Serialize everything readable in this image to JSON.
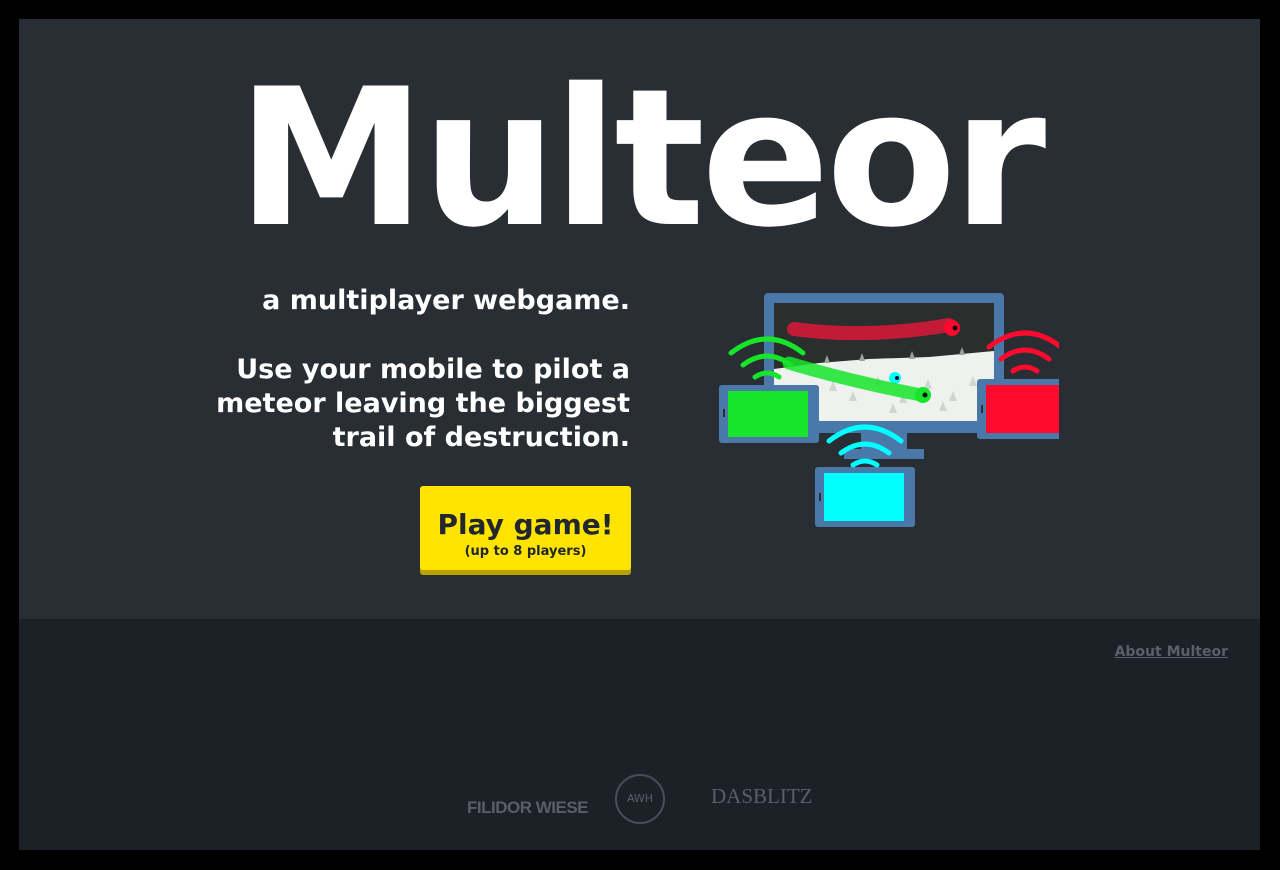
{
  "hero": {
    "title": "Multeor",
    "tagline": "a multiplayer webgame.",
    "description": "Use your mobile to pilot a meteor leaving the biggest trail of destruction.",
    "play_button": {
      "label": "Play game!",
      "sublabel": "(up to 8 players)"
    }
  },
  "footer": {
    "about_link": "About Multeor",
    "sponsors": [
      {
        "name": "FILIDOR WIESE"
      },
      {
        "name": "AWH"
      },
      {
        "name": "DASBLITZ"
      }
    ]
  },
  "colors": {
    "background": "#292d34",
    "footer_background": "#1c2027",
    "button": "#ffe400",
    "player_green": "#16e52a",
    "player_red": "#ff0a2c",
    "player_cyan": "#00ffff",
    "device_frame": "#4a78a8"
  }
}
